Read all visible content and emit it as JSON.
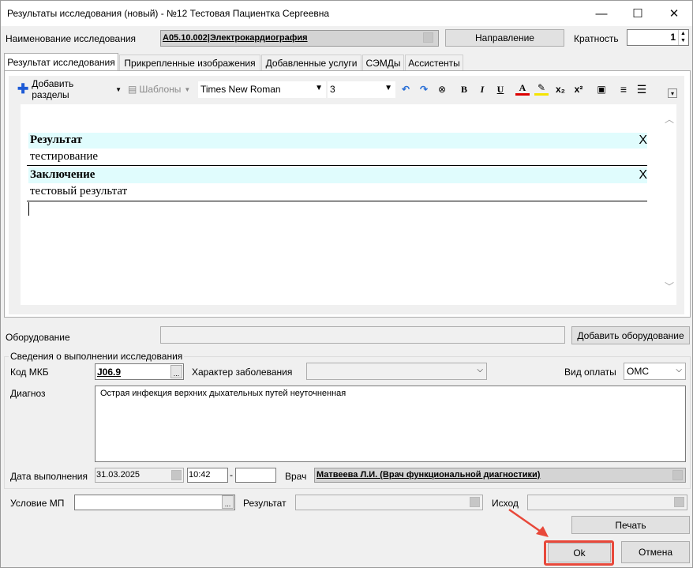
{
  "window": {
    "title": "Результаты исследования (новый) - №12 Тестовая Пациентка Сергеевна",
    "minimize_glyph": "—",
    "maximize_glyph": "☐",
    "close_glyph": "✕"
  },
  "header": {
    "study_name_label": "Наименование исследования",
    "study_name_value": "A05.10.002|Электрокардиография",
    "direction_button": "Направление",
    "multiplicity_label": "Кратность",
    "multiplicity_value": "1"
  },
  "tabs": [
    {
      "label": "Результат исследования",
      "active": true
    },
    {
      "label": "Прикрепленные изображения",
      "active": false
    },
    {
      "label": "Добавленные услуги",
      "active": false
    },
    {
      "label": "СЭМДы",
      "active": false
    },
    {
      "label": "Ассистенты",
      "active": false
    }
  ],
  "toolbar": {
    "add_sections": "Добавить разделы",
    "templates": "Шаблоны",
    "font_name": "Times New Roman",
    "font_size": "3",
    "bold": "B",
    "italic": "I",
    "underline": "U",
    "font_color": "A",
    "subscript": "x₂",
    "superscript": "x²"
  },
  "editor": {
    "sections": [
      {
        "title": "Результат",
        "text": "тестирование",
        "remove": "X"
      },
      {
        "title": "Заключение",
        "text": "тестовый результат",
        "remove": "X"
      }
    ]
  },
  "equipment": {
    "label": "Оборудование",
    "value": "",
    "add_button": "Добавить оборудование"
  },
  "execution": {
    "group_title": "Сведения о выполнении исследования",
    "mkb_label": "Код МКБ",
    "mkb_value": "J06.9",
    "disease_char_label": "Характер заболевания",
    "disease_char_value": "",
    "payment_label": "Вид оплаты",
    "payment_value": "ОМС",
    "diagnosis_label": "Диагноз",
    "diagnosis_value": "Острая инфекция верхних дыхательных путей неуточненная",
    "date_label": "Дата выполнения",
    "date_value": "31.03.2025",
    "time_value": "10:42",
    "time_sep": "-",
    "time_end_value": "",
    "doctor_label": "Врач",
    "doctor_value": "Матвеева Л.И. (Врач функциональной диагностики)"
  },
  "footer": {
    "condition_label": "Условие МП",
    "condition_value": "",
    "result_label": "Результат",
    "result_value": "",
    "outcome_label": "Исход",
    "outcome_value": "",
    "print_button": "Печать",
    "ok_button": "Ok",
    "cancel_button": "Отмена",
    "ellipsis": "..."
  },
  "colors": {
    "section_band": "#e0fcfd",
    "annotation_red": "#e8483a",
    "add_icon_blue": "#1e5bd6"
  }
}
